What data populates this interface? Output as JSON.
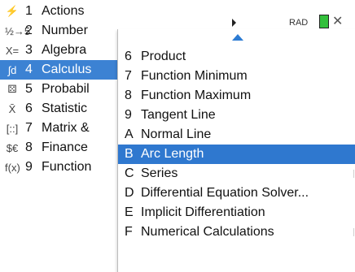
{
  "main_menu": {
    "items": [
      {
        "icon": "⚡",
        "num": "1",
        "label": "Actions",
        "selected": false
      },
      {
        "icon": "½→5",
        "num": "2",
        "label": "Number",
        "selected": false
      },
      {
        "icon": "X=",
        "num": "3",
        "label": "Algebra",
        "selected": false
      },
      {
        "icon": "∫d",
        "num": "4",
        "label": "Calculus",
        "selected": true
      },
      {
        "icon": "⚄",
        "num": "5",
        "label": "Probabil",
        "selected": false
      },
      {
        "icon": "X̄",
        "num": "6",
        "label": "Statistic",
        "selected": false
      },
      {
        "icon": "[::]",
        "num": "7",
        "label": "Matrix &",
        "selected": false
      },
      {
        "icon": "$€",
        "num": "8",
        "label": "Finance",
        "selected": false
      },
      {
        "icon": "f(x)",
        "num": "9",
        "label": "Function",
        "selected": false
      }
    ]
  },
  "status": {
    "mode": "RAD"
  },
  "submenu": {
    "items": [
      {
        "key": "6",
        "label": "Product",
        "selected": false
      },
      {
        "key": "7",
        "label": "Function Minimum",
        "selected": false
      },
      {
        "key": "8",
        "label": "Function Maximum",
        "selected": false
      },
      {
        "key": "9",
        "label": "Tangent Line",
        "selected": false
      },
      {
        "key": "A",
        "label": "Normal Line",
        "selected": false
      },
      {
        "key": "B",
        "label": "Arc Length",
        "selected": true
      },
      {
        "key": "C",
        "label": "Series",
        "selected": false
      },
      {
        "key": "D",
        "label": "Differential Equation Solver...",
        "selected": false
      },
      {
        "key": "E",
        "label": "Implicit Differentiation",
        "selected": false
      },
      {
        "key": "F",
        "label": "Numerical Calculations",
        "selected": false
      }
    ]
  },
  "colors": {
    "selection": "#2f78cf",
    "battery": "#33c03c"
  }
}
